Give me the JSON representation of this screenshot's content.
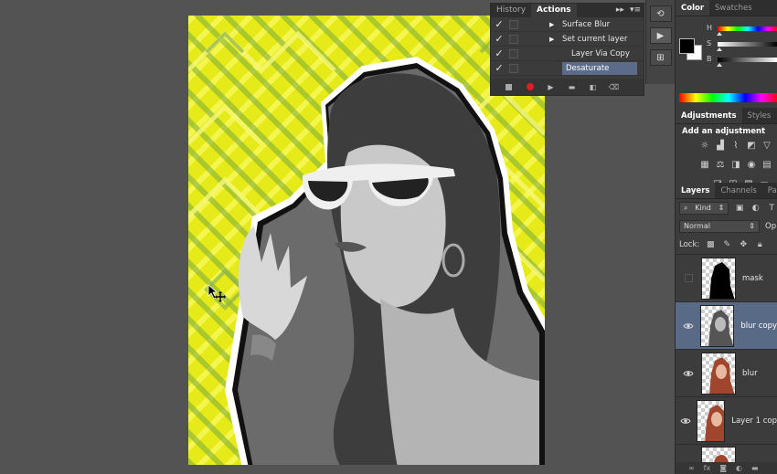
{
  "actions_panel": {
    "tabs": [
      {
        "label": "History",
        "active": false
      },
      {
        "label": "Actions",
        "active": true
      }
    ],
    "rows": [
      {
        "label": "Surface Blur",
        "checked": true,
        "expandable": true,
        "selected": false
      },
      {
        "label": "Set current layer",
        "checked": true,
        "expandable": true,
        "selected": false
      },
      {
        "label": "Layer Via Copy",
        "checked": true,
        "expandable": false,
        "selected": false
      },
      {
        "label": "Desaturate",
        "checked": true,
        "expandable": false,
        "selected": true
      }
    ],
    "footer_icons": [
      "stop-icon",
      "record-icon",
      "play-icon",
      "folder-icon",
      "new-action-icon",
      "trash-icon"
    ]
  },
  "color_panel": {
    "tabs": [
      {
        "label": "Color",
        "active": true
      },
      {
        "label": "Swatches",
        "active": false
      }
    ],
    "sliders": [
      {
        "label": "H"
      },
      {
        "label": "S"
      },
      {
        "label": "B"
      }
    ],
    "foreground": "#000000",
    "background": "#ffffff"
  },
  "adjustments_panel": {
    "tabs": [
      {
        "label": "Adjustments",
        "active": true
      },
      {
        "label": "Styles",
        "active": false
      }
    ],
    "title": "Add an adjustment"
  },
  "layers_panel": {
    "tabs": [
      {
        "label": "Layers",
        "active": true
      },
      {
        "label": "Channels",
        "active": false
      },
      {
        "label": "Paths",
        "active": false
      }
    ],
    "filter_label": "Kind",
    "blend_mode": "Normal",
    "opacity_label": "Op",
    "lock_label": "Lock:",
    "layers": [
      {
        "name": "mask",
        "visible": false,
        "selected": false,
        "thumb": "mask"
      },
      {
        "name": "blur copy",
        "visible": true,
        "selected": true,
        "thumb": "bw"
      },
      {
        "name": "blur",
        "visible": true,
        "selected": false,
        "thumb": "color"
      },
      {
        "name": "Layer 1 cop",
        "visible": true,
        "selected": false,
        "thumb": "color"
      }
    ]
  },
  "colors": {
    "accent_selection": "#596a86",
    "canvas_bg": "#e6ea19",
    "record_red": "#e11d1d"
  }
}
